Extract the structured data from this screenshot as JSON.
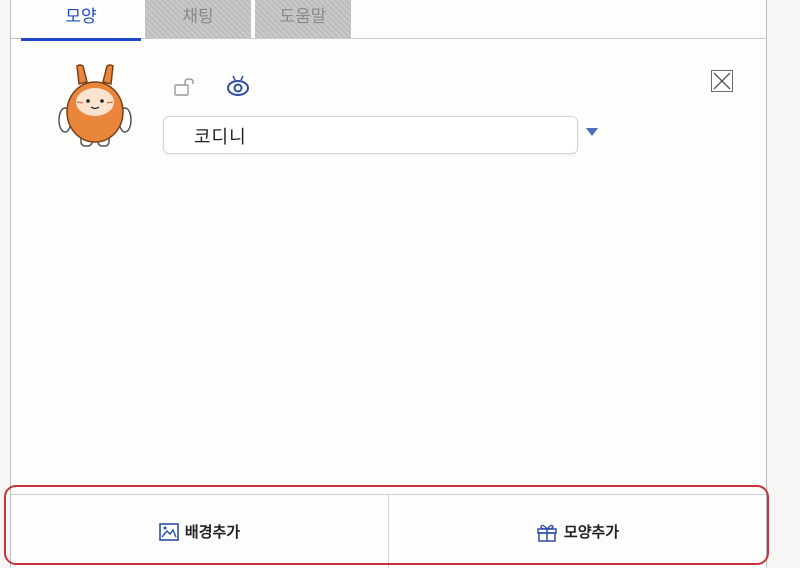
{
  "tabs": [
    {
      "label": "모양",
      "active": true
    },
    {
      "label": "채팅",
      "active": false
    },
    {
      "label": "도움말",
      "active": false
    }
  ],
  "sprite": {
    "avatar_icon": "codini-character",
    "lock_icon": "unlock-icon",
    "visibility_icon": "eye-icon",
    "name_value": "코디니",
    "dropdown_icon": "triangle-down-icon",
    "close_icon": "close-icon"
  },
  "actions": {
    "add_background_label": "배경추가",
    "add_background_icon": "image-icon",
    "add_shape_label": "모양추가",
    "add_shape_icon": "gift-icon"
  },
  "colors": {
    "accent": "#1f49c9",
    "character_orange": "#e9863b",
    "highlight_red": "#c8323a"
  }
}
